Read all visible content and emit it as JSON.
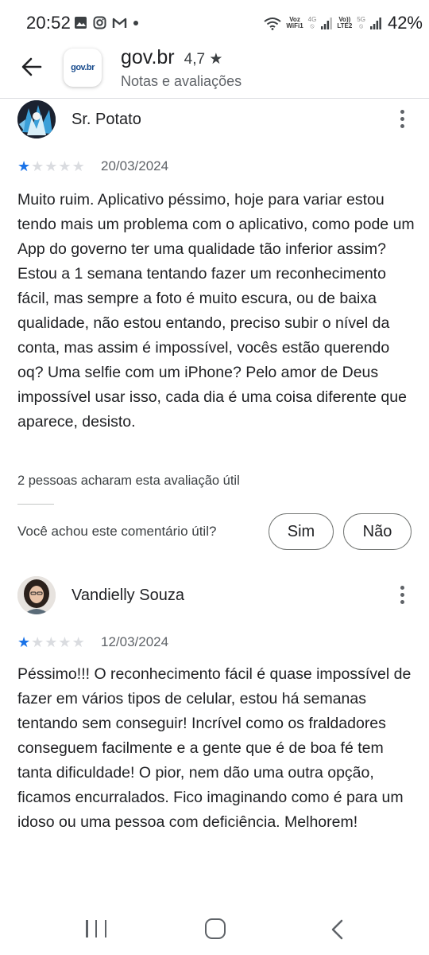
{
  "status_bar": {
    "time": "20:52",
    "left_icons": [
      "image-icon",
      "instagram-icon",
      "gmail-icon",
      "dot-icon"
    ],
    "voz_wifi_top": "Voz",
    "voz_wifi_bottom": "WiFi1",
    "net_4g": "4G",
    "volte_top": "Vo))",
    "volte_bottom": "LTE2",
    "net_5g": "5G",
    "battery": "42%"
  },
  "header": {
    "app_icon_text": "gov.br",
    "app_name": "gov.br",
    "rating": "4,7 ★",
    "subtitle": "Notas e avaliações"
  },
  "reviews": [
    {
      "name": "Sr. Potato",
      "stars": 1,
      "max_stars": 5,
      "date": "20/03/2024",
      "text": "Muito ruim. Aplicativo péssimo, hoje para variar estou tendo mais um problema com o aplicativo, como pode um App do governo ter uma qualidade tão inferior assim? Estou a 1 semana tentando fazer um reconhecimento fácil, mas sempre a foto é muito escura, ou de baixa qualidade, não estou entando, preciso subir o nível da conta, mas assim é impossível, vocês estão querendo oq? Uma selfie com um iPhone? Pelo amor de Deus impossível usar isso, cada dia é uma coisa diferente que aparece, desisto.",
      "helpful_count": "2 pessoas acharam esta avaliação útil",
      "helpful_question": "Você achou este comentário útil?",
      "yes_label": "Sim",
      "no_label": "Não"
    },
    {
      "name": "Vandielly Souza",
      "stars": 1,
      "max_stars": 5,
      "date": "12/03/2024",
      "text": "Péssimo!!! O reconhecimento fácil é quase impossível de fazer em vários tipos de celular, estou há semanas tentando sem conseguir! Incrível como os fraldadores conseguem facilmente e a gente que é de boa fé tem tanta dificuldade! O pior, nem dão uma outra opção, ficamos encurralados. Fico imaginando como é para um idoso ou uma pessoa com deficiência. Melhorem!"
    }
  ],
  "colors": {
    "star_filled": "#1a73e8",
    "star_empty": "#dadce0",
    "text_primary": "#202124",
    "text_secondary": "#5f6368"
  },
  "nav_bar": {
    "icons": [
      "recent-apps-icon",
      "home-icon",
      "back-icon"
    ]
  }
}
